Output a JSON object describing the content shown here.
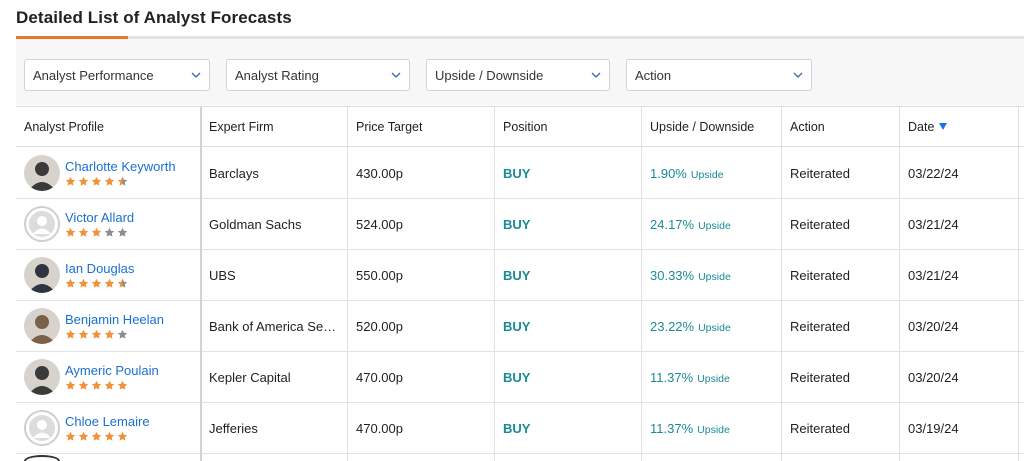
{
  "page_title": "Detailed List of Analyst Forecasts",
  "colors": {
    "accent": "#e8762c",
    "link": "#1a6fd1",
    "positive": "#1a8a96",
    "star_on": "#f0923a",
    "star_off": "#8e8e8e"
  },
  "filters": [
    {
      "label": "Analyst Performance",
      "icon": "chevron-down-icon"
    },
    {
      "label": "Analyst Rating",
      "icon": "chevron-down-icon"
    },
    {
      "label": "Upside / Downside",
      "icon": "chevron-down-icon"
    },
    {
      "label": "Action",
      "icon": "chevron-down-icon"
    }
  ],
  "columns": {
    "analyst": "Analyst Profile",
    "firm": "Expert Firm",
    "target": "Price Target",
    "position": "Position",
    "updown": "Upside / Downside",
    "action": "Action",
    "date": "Date",
    "date_sort_icon": "sort-desc-icon"
  },
  "rows": [
    {
      "name": "Charlotte Keyworth",
      "avatar": "photo",
      "stars": 4.5,
      "firm": "Barclays",
      "target": "430.00p",
      "position": "BUY",
      "updown_value": "1.90%",
      "updown_label": "Upside",
      "action": "Reiterated",
      "date": "03/22/24"
    },
    {
      "name": "Victor Allard",
      "avatar": "placeholder",
      "stars": 3,
      "firm": "Goldman Sachs",
      "target": "524.00p",
      "position": "BUY",
      "updown_value": "24.17%",
      "updown_label": "Upside",
      "action": "Reiterated",
      "date": "03/21/24"
    },
    {
      "name": "Ian Douglas",
      "avatar": "photo",
      "stars": 4.5,
      "firm": "UBS",
      "target": "550.00p",
      "position": "BUY",
      "updown_value": "30.33%",
      "updown_label": "Upside",
      "action": "Reiterated",
      "date": "03/21/24"
    },
    {
      "name": "Benjamin Heelan",
      "avatar": "photo",
      "stars": 4,
      "firm": "Bank of America Se…",
      "target": "520.00p",
      "position": "BUY",
      "updown_value": "23.22%",
      "updown_label": "Upside",
      "action": "Reiterated",
      "date": "03/20/24"
    },
    {
      "name": "Aymeric Poulain",
      "avatar": "photo",
      "stars": 5,
      "firm": "Kepler Capital",
      "target": "470.00p",
      "position": "BUY",
      "updown_value": "11.37%",
      "updown_label": "Upside",
      "action": "Reiterated",
      "date": "03/20/24"
    },
    {
      "name": "Chloe Lemaire",
      "avatar": "placeholder",
      "stars": 5,
      "firm": "Jefferies",
      "target": "470.00p",
      "position": "BUY",
      "updown_value": "11.37%",
      "updown_label": "Upside",
      "action": "Reiterated",
      "date": "03/19/24"
    }
  ]
}
